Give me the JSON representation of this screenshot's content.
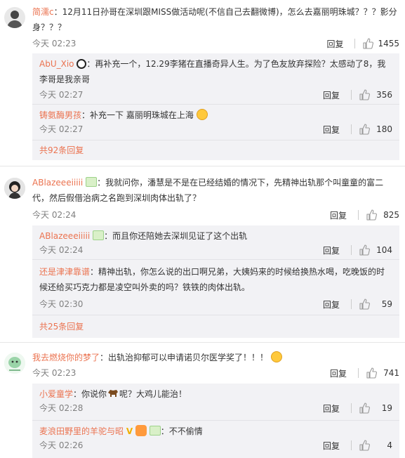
{
  "comments": [
    {
      "user": "简濡c",
      "text": "：12月11日孙哥在深圳跟MISS做活动呢(不信自己去翻微博)，怎么去嘉丽明珠城？？？影分身？？？",
      "time": "今天 02:23",
      "reply_label": "回复",
      "likes": "1455",
      "replies": [
        {
          "user": "AbU_Xio",
          "text": "：再补充一个，12.29李猪在直播奇异人生。为了色友放弃探险？太感动了8，我李哥是我亲哥",
          "time": "今天 02:27",
          "reply_label": "回复",
          "likes": "356"
        },
        {
          "user": "铸氨酶男孩",
          "text": "：补充一下 嘉丽明珠城在上海",
          "time": "今天 02:27",
          "reply_label": "回复",
          "likes": "180"
        }
      ],
      "more": "共92条回复"
    },
    {
      "user": "ABlazeeeiiiii",
      "text": "：我就问你，潘慧是不是在已经结婚的情况下，先精神出轨那个叫童童的富二代，然后假借治病之名跑到深圳肉体出轨了？",
      "time": "今天 02:24",
      "reply_label": "回复",
      "likes": "825",
      "replies": [
        {
          "user": "ABlazeeeiiiii",
          "text": "：而且你还陪她去深圳见证了这个出轨",
          "time": "今天 02:24",
          "reply_label": "回复",
          "likes": "104"
        },
        {
          "user": "还是津津靠谱",
          "text": "：精神出轨，你怎么说的出口啊兄弟，大姨妈来的时候给换热水喝，吃晚饭的时候还给买巧克力都是凌空叫外卖的吗？铁铁的肉体出轨。",
          "time": "今天 02:30",
          "reply_label": "回复",
          "likes": "59"
        }
      ],
      "more": "共25条回复"
    },
    {
      "user": "我去燃烧你的梦了",
      "text": "：出轨治抑郁可以申请诺贝尔医学奖了！！！",
      "time": "今天 02:23",
      "reply_label": "回复",
      "likes": "741",
      "replies": [
        {
          "user": "小爱童学",
          "text": "：你说你",
          "text2": "呢？大鸡儿能治！",
          "time": "今天 02:28",
          "reply_label": "回复",
          "likes": "19"
        },
        {
          "user": "麦浪田野里的羊驼与昭",
          "text": "：不不偷情",
          "time": "今天 02:26",
          "reply_label": "回复",
          "likes": "4"
        }
      ]
    }
  ],
  "colors": {
    "accent": "#eb7350",
    "subbg": "#f2f2f5"
  }
}
